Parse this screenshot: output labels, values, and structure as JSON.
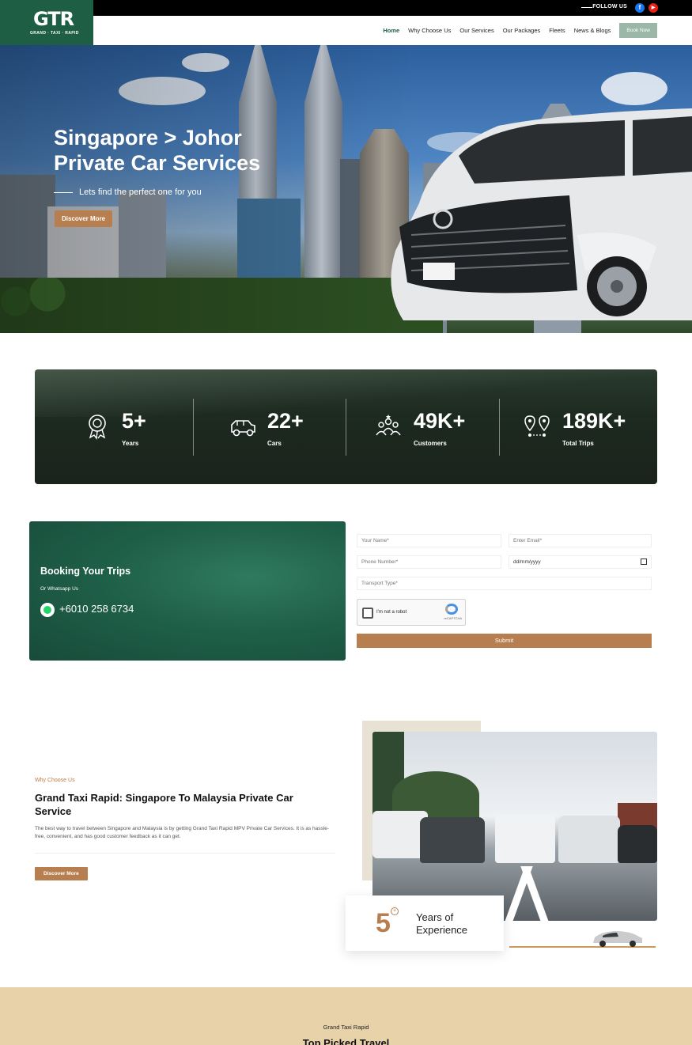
{
  "topbar": {
    "follow_label": "FOLLOW US",
    "fb": "f",
    "yt": "▶"
  },
  "logo": {
    "mark": "GTR",
    "sub": "GRAND · TAXI · RAPID"
  },
  "nav": {
    "items": [
      "Home",
      "Why Choose Us",
      "Our Services",
      "Our Packages",
      "Fleets",
      "News & Blogs"
    ],
    "book": "Book Now"
  },
  "hero": {
    "title": "Singapore > Johor Private Car Services",
    "subtitle": "Lets find the perfect one for you",
    "cta": "Discover More"
  },
  "stats": [
    {
      "value": "5+",
      "label": "Years",
      "icon": "award-icon"
    },
    {
      "value": "22+",
      "label": "Cars",
      "icon": "jeep-icon"
    },
    {
      "value": "49K+",
      "label": "Customers",
      "icon": "customers-icon"
    },
    {
      "value": "189K+",
      "label": "Total Trips",
      "icon": "route-pins-icon"
    }
  ],
  "booking": {
    "title": "Booking Your Trips",
    "or": "Or Whatsapp Us",
    "phone": "+6010 258 6734"
  },
  "form": {
    "name_ph": "Your Name*",
    "email_ph": "Enter Email*",
    "phone_ph": "Phone Number*",
    "date_ph": "dd/mm/yyyy",
    "transport_ph": "Transport Type*",
    "captcha_label": "I'm not a robot",
    "captcha_brand": "reCAPTCHA",
    "submit": "Submit"
  },
  "why": {
    "kicker": "Why Choose Us",
    "title": "Grand Taxi Rapid: Singapore To Malaysia Private Car Service",
    "text": "The best way to travel between Singapore and Malaysia is by getting Grand Taxi Rapid MPV Private Car Services. It is as hassle-free, convenient, and has good customer feedback as it can get.",
    "cta": "Discover More"
  },
  "experience": {
    "number": "5",
    "plus": "+",
    "text": "Years of Experience"
  },
  "bottom": {
    "kicker": "Grand Taxi Rapid",
    "title": "Top Picked Travel"
  },
  "colors": {
    "brand_green": "#1e5e44",
    "accent": "#b77f4f",
    "sand": "#e8d2aa"
  }
}
